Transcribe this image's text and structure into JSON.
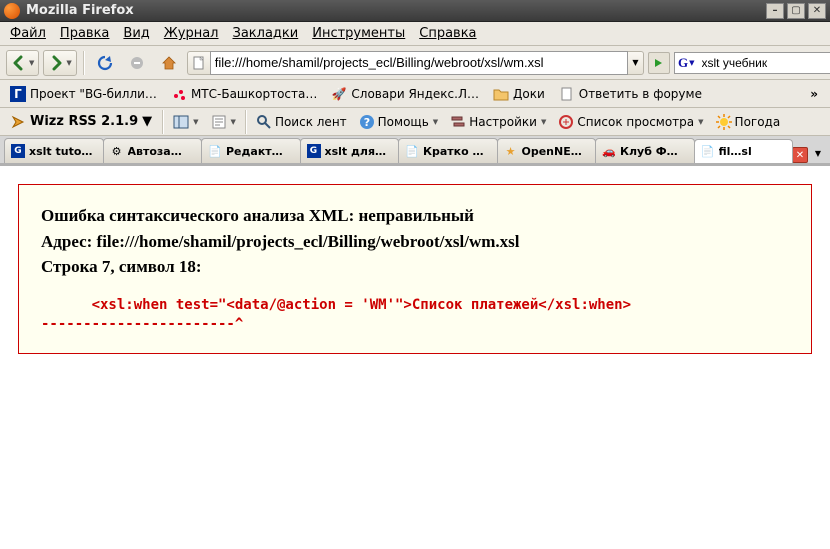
{
  "titlebar": {
    "app_name": "Mozilla Firefox"
  },
  "menubar": {
    "items": [
      "Файл",
      "Правка",
      "Вид",
      "Журнал",
      "Закладки",
      "Инструменты",
      "Справка"
    ]
  },
  "nav": {
    "url": "file:///home/shamil/projects_ecl/Billing/webroot/xsl/wm.xsl",
    "search_engine": "G",
    "search_value": "xslt учебник"
  },
  "bookmarks": {
    "items": [
      {
        "label": "Проект \"BG-билли…",
        "icon": "g-square"
      },
      {
        "label": "МТС-Башкортоста…",
        "icon": "mts"
      },
      {
        "label": "Словари Яндекс.Л…",
        "icon": "rocket"
      },
      {
        "label": "Доки",
        "icon": "folder"
      },
      {
        "label": "Ответить в форуме",
        "icon": "page"
      }
    ]
  },
  "rssbar": {
    "title": "Wizz RSS 2.1.9",
    "tools": [
      {
        "label": "Поиск лент",
        "icon": "search"
      },
      {
        "label": "Помощь",
        "icon": "help",
        "dd": true
      },
      {
        "label": "Настройки",
        "icon": "settings",
        "dd": true
      },
      {
        "label": "Список просмотра",
        "icon": "list",
        "dd": true
      },
      {
        "label": "Погода",
        "icon": "sun"
      }
    ]
  },
  "tabs": {
    "items": [
      {
        "label": "xslt tuto…",
        "icon": "g-square"
      },
      {
        "label": "Автоза…",
        "icon": "gear"
      },
      {
        "label": "Редакт…",
        "icon": "page"
      },
      {
        "label": "xslt для…",
        "icon": "g-square"
      },
      {
        "label": "Кратко …",
        "icon": "page"
      },
      {
        "label": "OpenNE…",
        "icon": "star"
      },
      {
        "label": "Клуб Ф…",
        "icon": "car"
      },
      {
        "label": "fil…sl",
        "icon": "page",
        "active": true
      }
    ]
  },
  "error": {
    "line1": "Ошибка синтаксического анализа XML: неправильный",
    "line2": "Адрес: file:///home/shamil/projects_ecl/Billing/webroot/xsl/wm.xsl",
    "line3": "Строка 7, символ 18:",
    "code": "      <xsl:when test=\"<data/@action = 'WM'\">Список платежей</xsl:when>",
    "caret": "-----------------------^"
  }
}
